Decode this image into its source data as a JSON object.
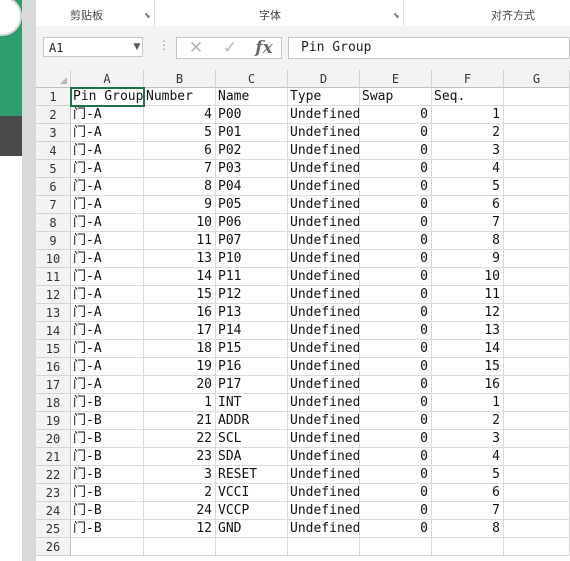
{
  "ribbon": {
    "clipboard": "剪贴板",
    "font": "字体",
    "alignment": "对齐方式"
  },
  "formula_bar": {
    "name_box": "A1",
    "cancel_icon": "✕",
    "enter_icon": "✓",
    "fx_label": "fx",
    "content": "Pin Group"
  },
  "columns": [
    "A",
    "B",
    "C",
    "D",
    "E",
    "F",
    "G"
  ],
  "rows": [
    {
      "n": "1",
      "a": "Pin Group",
      "b": "Number",
      "c": "Name",
      "d": "Type",
      "e": "Swap",
      "f": "Seq."
    },
    {
      "n": "2",
      "a": "门-A",
      "b": "4",
      "c": "P00",
      "d": "Undefined",
      "e": "0",
      "f": "1"
    },
    {
      "n": "3",
      "a": "门-A",
      "b": "5",
      "c": "P01",
      "d": "Undefined",
      "e": "0",
      "f": "2"
    },
    {
      "n": "4",
      "a": "门-A",
      "b": "6",
      "c": "P02",
      "d": "Undefined",
      "e": "0",
      "f": "3"
    },
    {
      "n": "5",
      "a": "门-A",
      "b": "7",
      "c": "P03",
      "d": "Undefined",
      "e": "0",
      "f": "4"
    },
    {
      "n": "6",
      "a": "门-A",
      "b": "8",
      "c": "P04",
      "d": "Undefined",
      "e": "0",
      "f": "5"
    },
    {
      "n": "7",
      "a": "门-A",
      "b": "9",
      "c": "P05",
      "d": "Undefined",
      "e": "0",
      "f": "6"
    },
    {
      "n": "8",
      "a": "门-A",
      "b": "10",
      "c": "P06",
      "d": "Undefined",
      "e": "0",
      "f": "7"
    },
    {
      "n": "9",
      "a": "门-A",
      "b": "11",
      "c": "P07",
      "d": "Undefined",
      "e": "0",
      "f": "8"
    },
    {
      "n": "10",
      "a": "门-A",
      "b": "13",
      "c": "P10",
      "d": "Undefined",
      "e": "0",
      "f": "9"
    },
    {
      "n": "11",
      "a": "门-A",
      "b": "14",
      "c": "P11",
      "d": "Undefined",
      "e": "0",
      "f": "10"
    },
    {
      "n": "12",
      "a": "门-A",
      "b": "15",
      "c": "P12",
      "d": "Undefined",
      "e": "0",
      "f": "11"
    },
    {
      "n": "13",
      "a": "门-A",
      "b": "16",
      "c": "P13",
      "d": "Undefined",
      "e": "0",
      "f": "12"
    },
    {
      "n": "14",
      "a": "门-A",
      "b": "17",
      "c": "P14",
      "d": "Undefined",
      "e": "0",
      "f": "13"
    },
    {
      "n": "15",
      "a": "门-A",
      "b": "18",
      "c": "P15",
      "d": "Undefined",
      "e": "0",
      "f": "14"
    },
    {
      "n": "16",
      "a": "门-A",
      "b": "19",
      "c": "P16",
      "d": "Undefined",
      "e": "0",
      "f": "15"
    },
    {
      "n": "17",
      "a": "门-A",
      "b": "20",
      "c": "P17",
      "d": "Undefined",
      "e": "0",
      "f": "16"
    },
    {
      "n": "18",
      "a": "门-B",
      "b": "1",
      "c": "INT",
      "d": "Undefined",
      "e": "0",
      "f": "1"
    },
    {
      "n": "19",
      "a": "门-B",
      "b": "21",
      "c": "ADDR",
      "d": "Undefined",
      "e": "0",
      "f": "2"
    },
    {
      "n": "20",
      "a": "门-B",
      "b": "22",
      "c": "SCL",
      "d": "Undefined",
      "e": "0",
      "f": "3"
    },
    {
      "n": "21",
      "a": "门-B",
      "b": "23",
      "c": "SDA",
      "d": "Undefined",
      "e": "0",
      "f": "4"
    },
    {
      "n": "22",
      "a": "门-B",
      "b": "3",
      "c": "RESET",
      "d": "Undefined",
      "e": "0",
      "f": "5"
    },
    {
      "n": "23",
      "a": "门-B",
      "b": "2",
      "c": "VCCI",
      "d": "Undefined",
      "e": "0",
      "f": "6"
    },
    {
      "n": "24",
      "a": "门-B",
      "b": "24",
      "c": "VCCP",
      "d": "Undefined",
      "e": "0",
      "f": "7"
    },
    {
      "n": "25",
      "a": "门-B",
      "b": "12",
      "c": "GND",
      "d": "Undefined",
      "e": "0",
      "f": "8"
    },
    {
      "n": "26",
      "a": "",
      "b": "",
      "c": "",
      "d": "",
      "e": "",
      "f": ""
    }
  ],
  "colors": {
    "selection": "#217346",
    "app_green": "#2f9e6f"
  }
}
